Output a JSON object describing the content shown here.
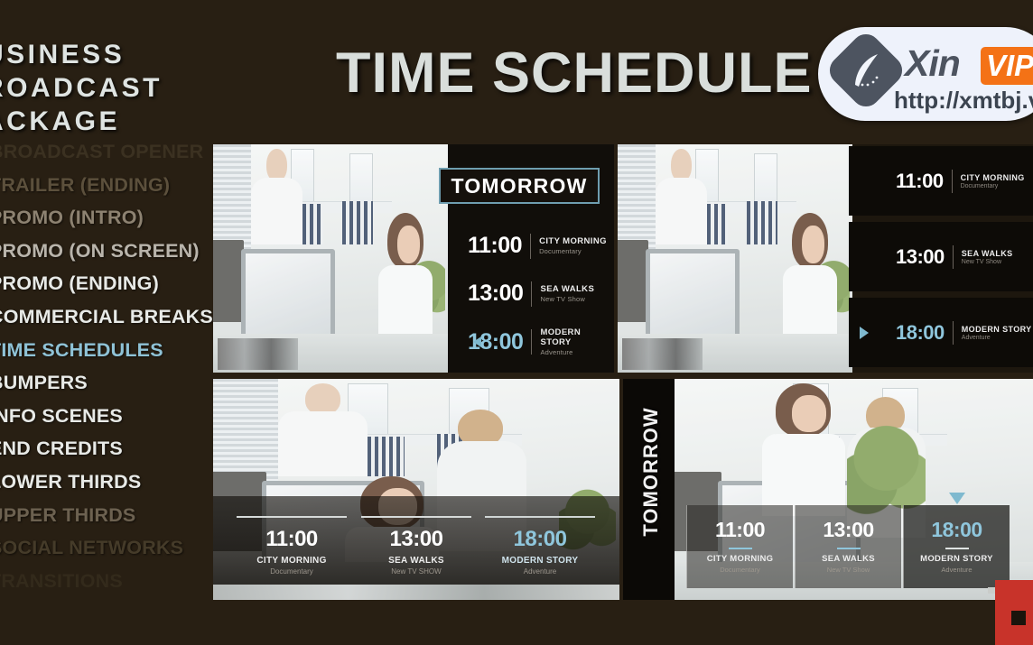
{
  "sidebar": {
    "brand_lines": [
      "USINESS",
      "ROADCAST",
      "ACKAGE"
    ],
    "menu": [
      {
        "label": "BROADCAST OPENER",
        "state": "ghost"
      },
      {
        "label": "TRAILER (ENDING)",
        "state": "f1"
      },
      {
        "label": "PROMO (INTRO)",
        "state": "f2"
      },
      {
        "label": "PROMO (ON SCREEN)",
        "state": "f3"
      },
      {
        "label": "PROMO (ENDING)",
        "state": "normal"
      },
      {
        "label": "COMMERCIAL BREAKS",
        "state": "normal"
      },
      {
        "label": "TIME SCHEDULES",
        "state": "active"
      },
      {
        "label": "BUMPERS",
        "state": "normal"
      },
      {
        "label": "INFO SCENES",
        "state": "normal"
      },
      {
        "label": "END CREDITS",
        "state": "normal"
      },
      {
        "label": "LOWER THIRDS",
        "state": "normal"
      },
      {
        "label": "UPPER THIRDS",
        "state": "dim1"
      },
      {
        "label": "SOCIAL NETWORKS",
        "state": "dim2"
      },
      {
        "label": "TRANSITIONS",
        "state": "dim3"
      }
    ]
  },
  "header": {
    "title": "TIME SCHEDULE"
  },
  "watermark": {
    "brand": "Xin",
    "badge": "VIP",
    "url": "http://xmtbj.vi"
  },
  "schedule": {
    "day_label": "TOMORROW",
    "entries": [
      {
        "time": "11:00",
        "title": "CITY MORNING",
        "subtitle": "Documentary",
        "highlighted": false
      },
      {
        "time": "13:00",
        "title": "SEA WALKS",
        "subtitle": "New TV Show",
        "highlighted": false
      },
      {
        "time": "18:00",
        "title": "MODERN STORY",
        "subtitle": "Adventure",
        "highlighted": true
      }
    ],
    "entries_alt_subtitle": [
      "Documentary",
      "New TV SHOW",
      "Adventure"
    ]
  },
  "colors": {
    "background": "#281f13",
    "accent": "#8fc6dc",
    "panel": "#0d0b07",
    "text": "#ececec",
    "vip_orange": "#f47216",
    "red_logo": "#c8332a"
  }
}
